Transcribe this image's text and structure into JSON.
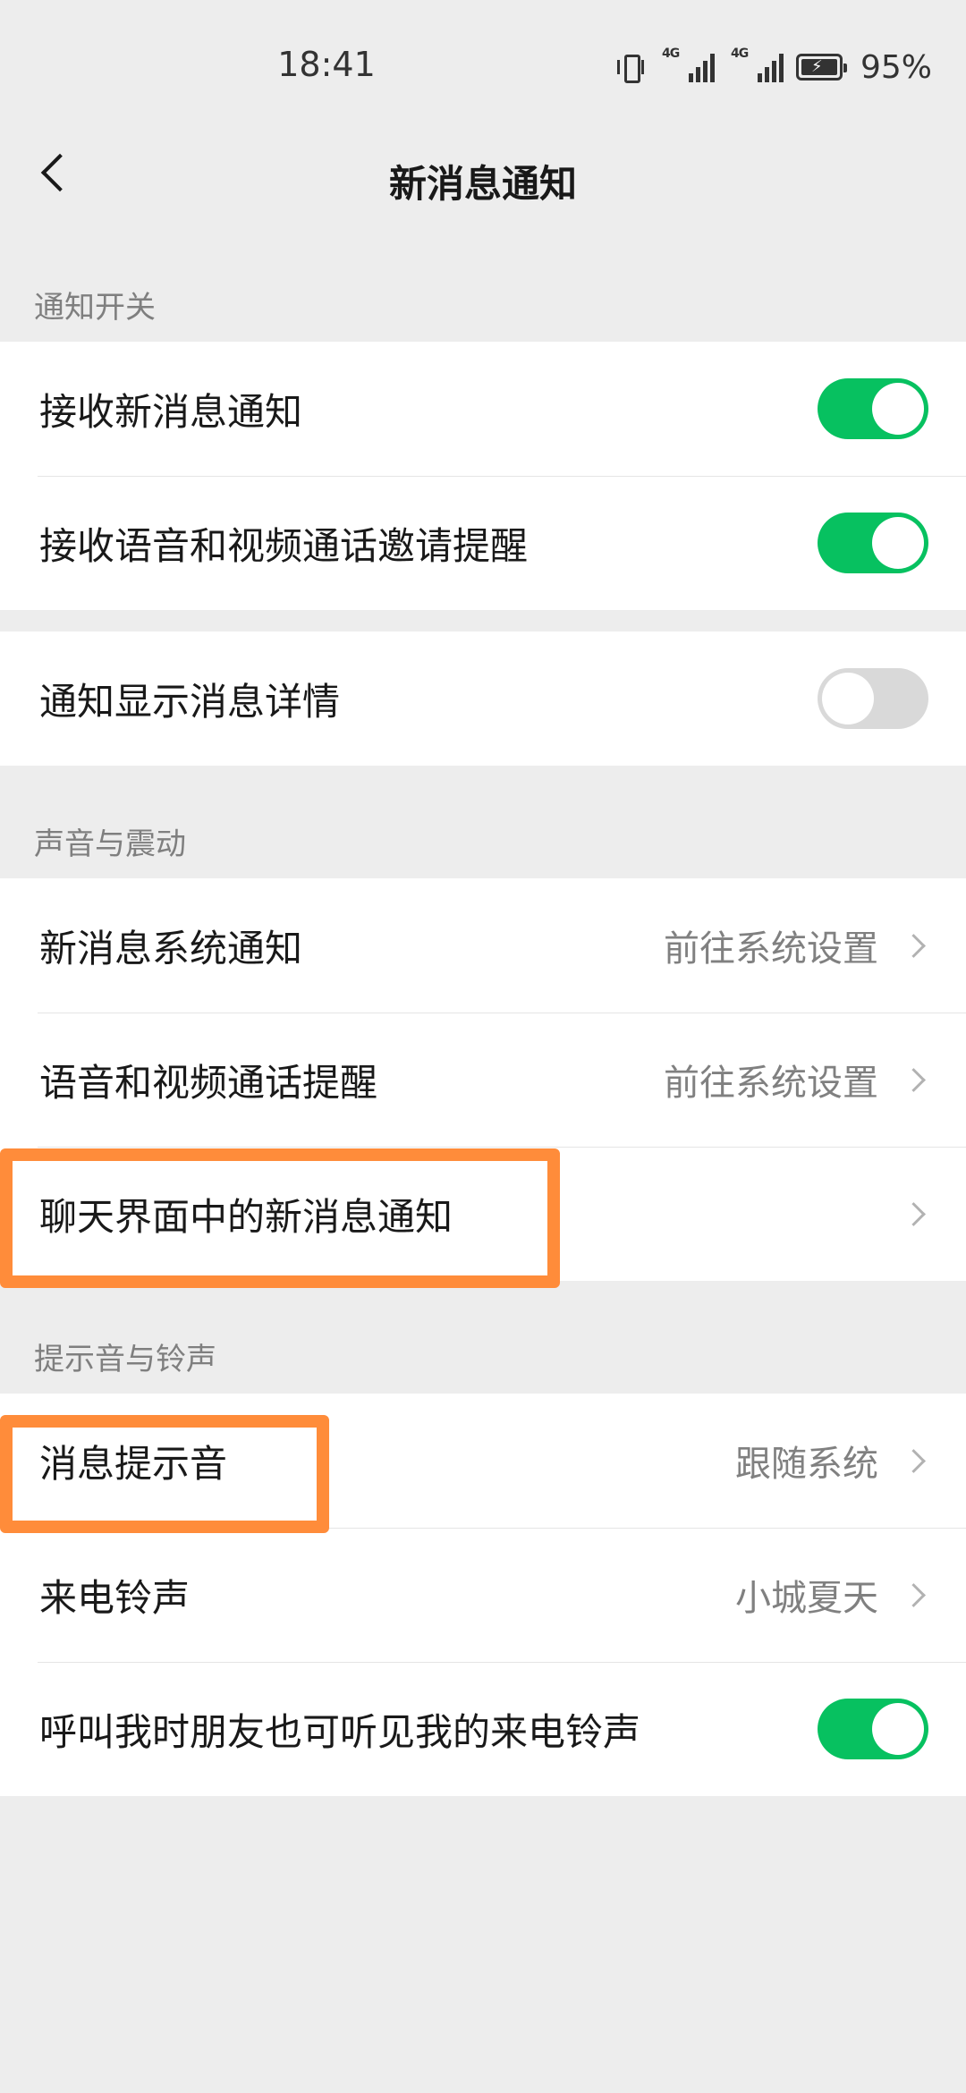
{
  "status_bar": {
    "time": "18:41",
    "network_1": "4G",
    "network_2": "4G",
    "battery_percent": "95%",
    "icons": [
      "vibrate-icon",
      "signal-4g-icon",
      "signal-4g-icon",
      "battery-charging-icon"
    ]
  },
  "nav": {
    "title": "新消息通知",
    "back_icon": "chevron-left-icon"
  },
  "sections": {
    "notify_switch_title": "通知开关",
    "sound_vibration_title": "声音与震动",
    "tone_ringtone_title": "提示音与铃声"
  },
  "rows": {
    "receive_new_msg": {
      "label": "接收新消息通知",
      "toggle": true
    },
    "receive_call_invite": {
      "label": "接收语音和视频通话邀请提醒",
      "toggle": true
    },
    "show_msg_detail": {
      "label": "通知显示消息详情",
      "toggle": false
    },
    "system_notify": {
      "label": "新消息系统通知",
      "value": "前往系统设置"
    },
    "call_remind": {
      "label": "语音和视频通话提醒",
      "value": "前往系统设置"
    },
    "chat_new_msg": {
      "label": "聊天界面中的新消息通知"
    },
    "msg_tone": {
      "label": "消息提示音",
      "value": "跟随系统"
    },
    "ringtone": {
      "label": "来电铃声",
      "value": "小城夏天"
    },
    "friends_hear_ringtone": {
      "label": "呼叫我时朋友也可听见我的来电铃声",
      "toggle": true
    }
  },
  "colors": {
    "toggle_on": "#07c160",
    "toggle_off": "#d9d9d9",
    "highlight": "#ff8c3a",
    "background": "#ededed"
  }
}
